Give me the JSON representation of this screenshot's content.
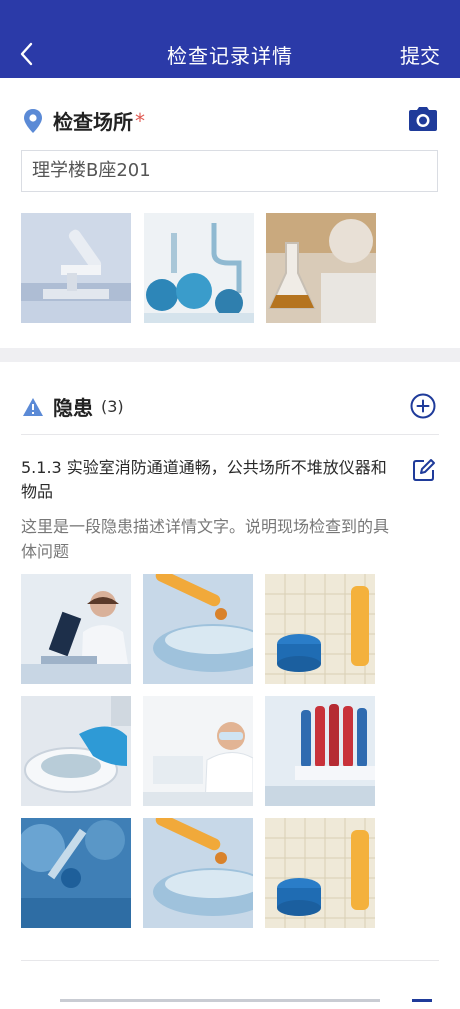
{
  "header": {
    "title": "检查记录详情",
    "submit_label": "提交"
  },
  "location": {
    "label": "检查场所",
    "required_mark": "*",
    "value": "理学楼B座201",
    "photos": [
      "microscope-photo",
      "glass-flasks-photo",
      "scientist-flask-photo"
    ]
  },
  "hazards": {
    "label": "隐患",
    "count": "(3)",
    "item": {
      "title": "5.1.3  实验室消防通道通畅，公共场所不堆放仪器和物品",
      "description": "这里是一段隐患描述详情文字。说明现场检查到的具体问题",
      "photos": [
        "scientist-microscope-photo",
        "pipette-drop-photo",
        "periodic-table-vial-photo",
        "petri-dish-photo",
        "scientist-goggles-photo",
        "test-tube-rack-photo",
        "glass-dropper-photo",
        "pipette-drop-photo",
        "periodic-table-vial-photo"
      ]
    }
  },
  "colors": {
    "header_bg": "#2b3aa8",
    "accent": "#1f3b9a",
    "location_pin": "#5b8ad6",
    "warning": "#5b8ad6",
    "required": "#e05a52"
  }
}
